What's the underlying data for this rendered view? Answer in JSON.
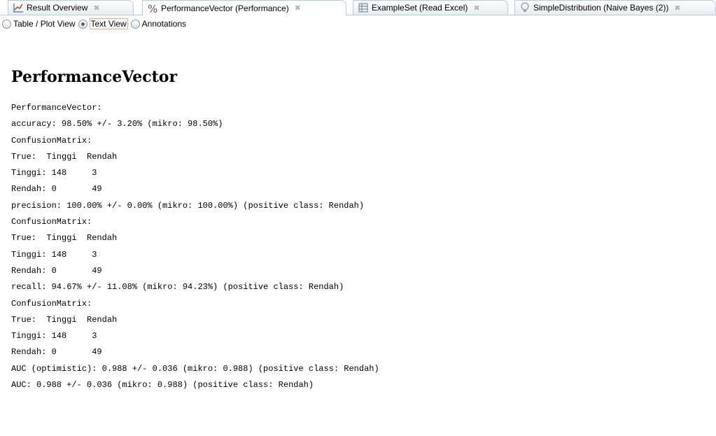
{
  "tabs": [
    {
      "label": "Result Overview",
      "icon": "chart-icon",
      "active": false
    },
    {
      "label": "PerformanceVector (Performance)",
      "icon": "percent-icon",
      "active": true
    },
    {
      "label": "ExampleSet (Read Excel)",
      "icon": "table-icon",
      "active": false
    },
    {
      "label": "SimpleDistribution (Naive Bayes (2))",
      "icon": "lightbulb-icon",
      "active": false
    }
  ],
  "view_modes": {
    "table_plot": "Table / Plot View",
    "text": "Text View",
    "annotations": "Annotations",
    "selected": "text"
  },
  "title": "PerformanceVector",
  "lines": [
    "PerformanceVector:",
    "accuracy: 98.50% +/- 3.20% (mikro: 98.50%)",
    "ConfusionMatrix:",
    "True:  Tinggi  Rendah",
    "Tinggi: 148     3",
    "Rendah: 0       49",
    "precision: 100.00% +/- 0.00% (mikro: 100.00%) (positive class: Rendah)",
    "ConfusionMatrix:",
    "True:  Tinggi  Rendah",
    "Tinggi: 148     3",
    "Rendah: 0       49",
    "recall: 94.67% +/- 11.08% (mikro: 94.23%) (positive class: Rendah)",
    "ConfusionMatrix:",
    "True:  Tinggi  Rendah",
    "Tinggi: 148     3",
    "Rendah: 0       49",
    "AUC (optimistic): 0.988 +/- 0.036 (mikro: 0.988) (positive class: Rendah)",
    "AUC: 0.988 +/- 0.036 (mikro: 0.988) (positive class: Rendah)"
  ]
}
